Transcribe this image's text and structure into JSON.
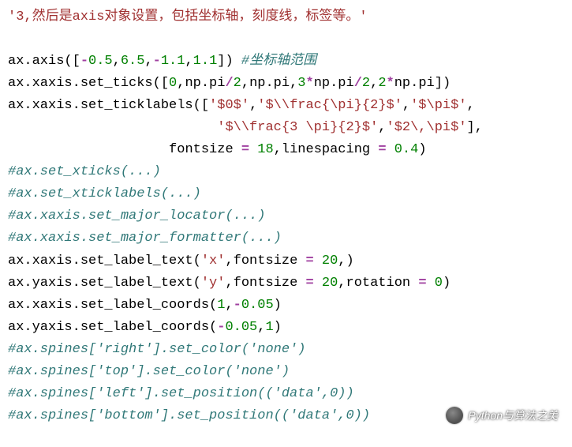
{
  "lines": {
    "l1": {
      "s1": "'3,然后是axis对象设置，包括坐标轴，刻度线，标签等。'"
    },
    "l3": {
      "p1": "ax.axis([",
      "n1": "-",
      "n1v": "0.5",
      "c1": ",",
      "n2": "6.5",
      "c2": ",",
      "n3": "-",
      "n3v": "1.1",
      "c3": ",",
      "n4": "1.1",
      "p2": "]) ",
      "cm": "#坐标轴范围"
    },
    "l4": {
      "p1": "ax.xaxis.set_ticks([",
      "n1": "0",
      "c1": ",np.pi",
      "op1": "/",
      "n2": "2",
      "c2": ",np.pi,",
      "n3": "3",
      "op2": "*",
      "c3": "np.pi",
      "op3": "/",
      "n4": "2",
      "c4": ",",
      "n5": "2",
      "op4": "*",
      "c5": "np.pi])"
    },
    "l5": {
      "p1": "ax.xaxis.set_ticklabels([",
      "s1": "'$0$'",
      "c1": ",",
      "s2": "'$\\\\frac{\\pi}{2}$'",
      "c2": ",",
      "s3": "'$\\pi$'",
      "c3": ","
    },
    "l6": {
      "pad": "                          ",
      "s1": "'$\\\\frac{3 \\pi}{2}$'",
      "c1": ",",
      "s2": "'$2\\,\\pi$'",
      "c2": "],"
    },
    "l7": {
      "pad": "                    ",
      "p1": "fontsize ",
      "op1": "=",
      "sp1": " ",
      "n1": "18",
      "c1": ",linespacing ",
      "op2": "=",
      "sp2": " ",
      "n2": "0.4",
      "p2": ")"
    },
    "l8": {
      "cm": "#ax.set_xticks(...)"
    },
    "l9": {
      "cm": "#ax.set_xticklabels(...)"
    },
    "l10": {
      "cm": "#ax.xaxis.set_major_locator(...)"
    },
    "l11": {
      "cm": "#ax.xaxis.set_major_formatter(...)"
    },
    "l12": {
      "p1": "ax.xaxis.set_label_text(",
      "s1": "'x'",
      "c1": ",fontsize ",
      "op1": "=",
      "sp1": " ",
      "n1": "20",
      "c2": ",)"
    },
    "l13": {
      "p1": "ax.yaxis.set_label_text(",
      "s1": "'y'",
      "c1": ",fontsize ",
      "op1": "=",
      "sp1": " ",
      "n1": "20",
      "c2": ",rotation ",
      "op2": "=",
      "sp2": " ",
      "n2": "0",
      "c3": ")"
    },
    "l14": {
      "p1": "ax.xaxis.set_label_coords(",
      "n1": "1",
      "c1": ",",
      "n2": "-",
      "n2v": "0.05",
      "c2": ")"
    },
    "l15": {
      "p1": "ax.yaxis.set_label_coords(",
      "n1": "-",
      "n1v": "0.05",
      "c1": ",",
      "n2": "1",
      "c2": ")"
    },
    "l16": {
      "cm": "#ax.spines['right'].set_color('none')"
    },
    "l17": {
      "cm": "#ax.spines['top'].set_color('none')"
    },
    "l18": {
      "cm": "#ax.spines['left'].set_position(('data',0))"
    },
    "l19": {
      "cm": "#ax.spines['bottom'].set_position(('data',0))"
    }
  },
  "watermark": "Python与算法之美"
}
